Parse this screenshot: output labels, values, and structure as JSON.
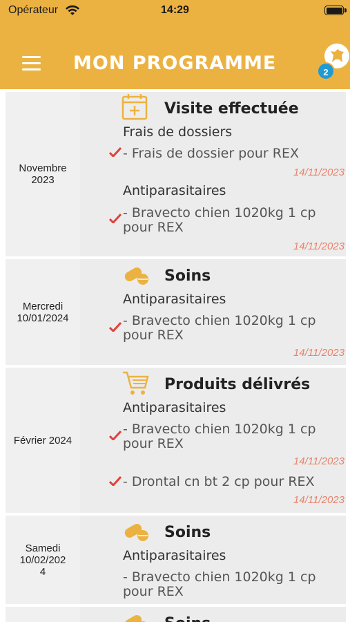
{
  "status_bar": {
    "carrier": "Opérateur",
    "time": "14:29"
  },
  "header": {
    "title": "MON PROGRAMME",
    "notification_count": "2"
  },
  "colors": {
    "header_bg": "#ecb241",
    "accent_icon": "#ecb241",
    "check": "#e0413a",
    "date_tag": "#e8826a",
    "badge": "#1e9ad6"
  },
  "cards": [
    {
      "date": "Novembre 2023",
      "icon": "calendar-plus-icon",
      "type": "Visite effectuée",
      "groups": [
        {
          "category": "Frais de dossiers",
          "items": [
            {
              "line1": "- Frais de dossier pour REX",
              "line2": "",
              "date": "14/11/2023",
              "checked": true
            }
          ]
        },
        {
          "category": "Antiparasitaires",
          "items": [
            {
              "line1": "- Bravecto chien 1020kg 1 cp",
              "line2": "pour REX",
              "date": "14/11/2023",
              "checked": true
            }
          ]
        }
      ]
    },
    {
      "date": "Mercredi 10/01/2024",
      "icon": "pills-icon",
      "type": "Soins",
      "groups": [
        {
          "category": "Antiparasitaires",
          "items": [
            {
              "line1": "- Bravecto chien 1020kg 1 cp",
              "line2": "pour REX",
              "date": "14/11/2023",
              "checked": true
            }
          ]
        }
      ]
    },
    {
      "date": "Février 2024",
      "icon": "cart-icon",
      "type": "Produits délivrés",
      "groups": [
        {
          "category": "Antiparasitaires",
          "items": [
            {
              "line1": "- Bravecto chien 1020kg 1 cp",
              "line2": "pour REX",
              "date": "14/11/2023",
              "checked": true
            },
            {
              "line1": "- Drontal cn bt 2 cp pour REX",
              "line2": "",
              "date": "14/11/2023",
              "checked": true
            }
          ]
        }
      ]
    },
    {
      "date": "Samedi 10/02/2024",
      "date_lines": [
        "Samedi",
        "10/02/202",
        "4"
      ],
      "icon": "pills-icon",
      "type": "Soins",
      "groups": [
        {
          "category": "Antiparasitaires",
          "items": [
            {
              "line1": "- Bravecto chien 1020kg 1 cp",
              "line2": "pour REX",
              "date": "",
              "checked": false
            }
          ]
        }
      ]
    },
    {
      "date": "",
      "icon": "pills-icon",
      "type": "Soins",
      "groups": []
    }
  ]
}
